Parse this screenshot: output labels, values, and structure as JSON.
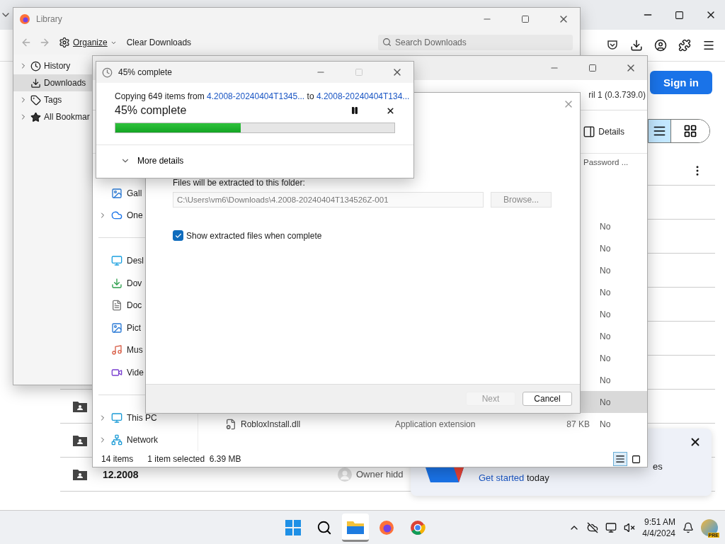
{
  "browser": {
    "sign_in": "Sign in",
    "view_toggle": [
      {
        "kind": "list",
        "selected": true
      },
      {
        "kind": "grid",
        "selected": false
      }
    ],
    "file_rows": [
      {
        "name": "12.2008",
        "owner": "Owner hidd"
      }
    ],
    "toast": {
      "fragment": "es",
      "link": "Get started",
      "text": "today"
    }
  },
  "library": {
    "title": "Library",
    "toolbar": {
      "organize": "Organize",
      "clear": "Clear Downloads",
      "search_placeholder": "Search Downloads"
    },
    "sidebar": [
      {
        "label": "History",
        "expandable": true,
        "selected": false
      },
      {
        "label": "Downloads",
        "expandable": false,
        "selected": true
      },
      {
        "label": "Tags",
        "expandable": true,
        "selected": false
      },
      {
        "label": "All Bookmar",
        "expandable": true,
        "selected": false
      }
    ]
  },
  "explorer": {
    "address_fragment": "ril 1 (0.3.739.0)",
    "details": "Details",
    "column_header": "Password ...",
    "sidebar": [
      {
        "kind": "item",
        "label": "Gall",
        "expandable": false
      },
      {
        "kind": "item",
        "label": "One",
        "expandable": true
      },
      {
        "kind": "divider"
      },
      {
        "kind": "item",
        "label": "Desl",
        "expandable": false
      },
      {
        "kind": "item",
        "label": "Dov",
        "expandable": false
      },
      {
        "kind": "item",
        "label": "Doc",
        "expandable": false
      },
      {
        "kind": "item",
        "label": "Pict",
        "expandable": false
      },
      {
        "kind": "item",
        "label": "Mus",
        "expandable": false
      },
      {
        "kind": "item",
        "label": "Vide",
        "expandable": false
      },
      {
        "kind": "divider"
      },
      {
        "kind": "item",
        "label": "This PC",
        "expandable": true
      },
      {
        "kind": "item",
        "label": "Network",
        "expandable": true
      }
    ],
    "rows": [
      {
        "password": "No",
        "selected": false
      },
      {
        "password": "No",
        "selected": false
      },
      {
        "password": "No",
        "selected": false
      },
      {
        "password": "No",
        "selected": false
      },
      {
        "password": "No",
        "selected": false
      },
      {
        "password": "No",
        "selected": false
      },
      {
        "password": "No",
        "selected": false
      },
      {
        "password": "No",
        "selected": false
      },
      {
        "password": "No",
        "selected": true
      },
      {
        "name": "RobloxInstall.dll",
        "type": "Application extension",
        "size": "87 KB",
        "password": "No",
        "selected": false
      }
    ],
    "status": {
      "count": "14 items",
      "selection": "1 item selected",
      "size": "6.39 MB"
    },
    "view_buttons": [
      {
        "kind": "details",
        "selected": true
      },
      {
        "kind": "tiles",
        "selected": false
      }
    ]
  },
  "extract": {
    "folder_label": "Files will be extracted to this folder:",
    "path": "C:\\Users\\vm6\\Downloads\\4.2008-20240404T134526Z-001",
    "browse": "Browse...",
    "show_files": {
      "label": "Show extracted files when complete",
      "checked": true
    },
    "buttons": [
      {
        "label": "Next",
        "disabled": true
      },
      {
        "label": "Cancel",
        "disabled": false
      }
    ]
  },
  "progress": {
    "title": "45% complete",
    "copying": "Copying 649 items from",
    "source": "4.2008-20240404T1345...",
    "to": "to",
    "destination": "4.2008-20240404T134...",
    "heading": "45% complete",
    "level": 0.45,
    "more": "More details"
  },
  "taskbar": {
    "apps": [
      {
        "kind": "start",
        "active": false
      },
      {
        "kind": "search",
        "active": false
      },
      {
        "kind": "explorer",
        "active": true
      },
      {
        "kind": "firefox",
        "active": false
      },
      {
        "kind": "chrome",
        "active": false
      }
    ],
    "time": "9:51 AM",
    "date": "4/4/2024",
    "badge": "PRE"
  }
}
